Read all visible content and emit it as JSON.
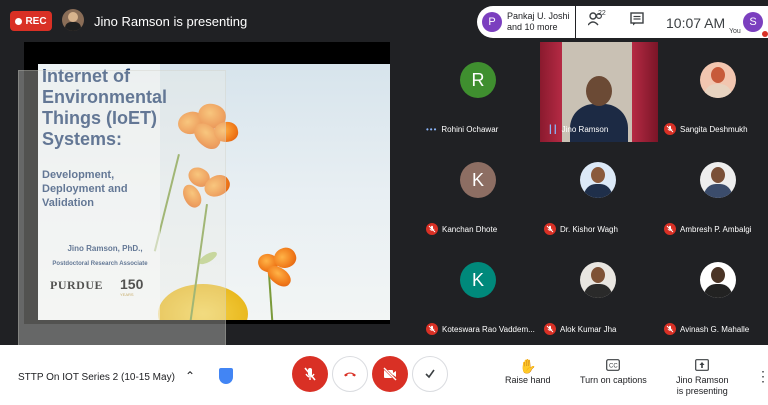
{
  "topbar": {
    "rec_label": "REC",
    "presenting_text": "Jino Ramson is presenting",
    "people_pill": {
      "avatar_letter": "P",
      "line1": "Pankaj U. Joshi",
      "line2": "and 10 more"
    },
    "participant_count": "22",
    "time": "10:07 AM",
    "self_avatar_letter": "S",
    "you_label": "You"
  },
  "slide": {
    "title": "Internet of Environmental Things (IoET) Systems:",
    "subtitle": "Development, Deployment and Validation",
    "author": "Jino Ramson, PhD.,",
    "role": "Postdoctoral Research Associate",
    "logo": "PURDUE",
    "anniversary": "150",
    "anniversary_small": "YEARS"
  },
  "participants": [
    {
      "name": "Rohini Ochawar",
      "initial": "R",
      "color": "#3f8f2f",
      "status": "speaking-dots"
    },
    {
      "name": "Jino Ramson",
      "status": "active-bars",
      "video": true
    },
    {
      "name": "Sangita Deshmukh",
      "status": "muted",
      "photo": true,
      "photo_colors": [
        "#f2c6b0",
        "#c75a3a",
        "#e7d3c0"
      ]
    },
    {
      "name": "Kanchan Dhote",
      "initial": "K",
      "color": "#8d6e63",
      "status": "muted"
    },
    {
      "name": "Dr. Kishor Wagh",
      "status": "muted",
      "photo": true,
      "photo_colors": [
        "#dce9f7",
        "#8a5a3c",
        "#1f2f4a"
      ]
    },
    {
      "name": "Ambresh P. Ambalgi",
      "status": "muted",
      "photo": true,
      "photo_colors": [
        "#eeeeee",
        "#7a5038",
        "#3b4c6b"
      ]
    },
    {
      "name": "Koteswara Rao Vaddem...",
      "initial": "K",
      "color": "#00897b",
      "status": "muted"
    },
    {
      "name": "Alok Kumar Jha",
      "status": "muted",
      "photo": true,
      "photo_colors": [
        "#e9e6e1",
        "#7e5236",
        "#2a2a2a"
      ]
    },
    {
      "name": "Avinash G. Mahalle",
      "status": "muted",
      "photo": true,
      "photo_colors": [
        "#ffffff",
        "#4a3426",
        "#222222"
      ]
    }
  ],
  "bottombar": {
    "meeting_title": "STTP On IOT Series 2 (10-15 May)",
    "raise_hand": "Raise hand",
    "captions": "Turn on captions",
    "presenting_line1": "Jino Ramson",
    "presenting_line2": "is presenting"
  },
  "colors": {
    "accent_red": "#d93025",
    "background": "#202124",
    "brand_purple": "#7b3fbf"
  }
}
